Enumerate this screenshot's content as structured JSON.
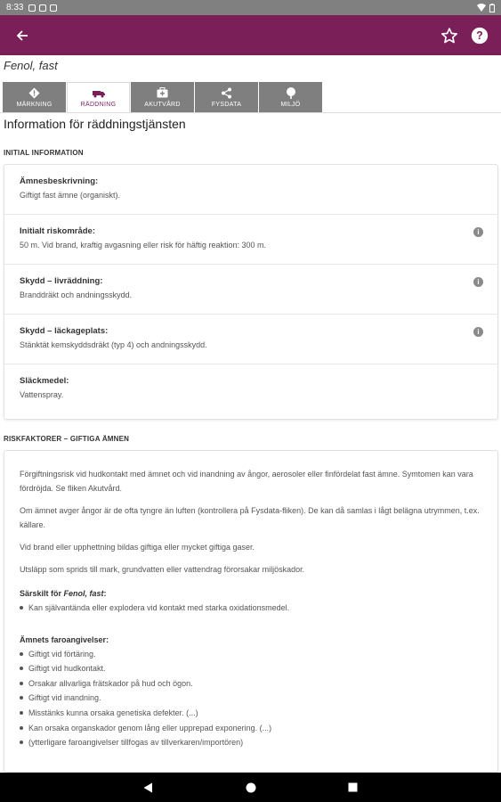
{
  "status_bar": {
    "time": "8:33"
  },
  "app_bar": {
    "back_icon": "arrow-left-icon",
    "favorite_icon": "star-outline-icon",
    "help_icon": "help-circle-icon",
    "color": "#7a1f57"
  },
  "substance": {
    "name": "Fenol, fast"
  },
  "tabs": [
    {
      "label": "MÄRKNING",
      "icon": "warning-diamond-icon",
      "active": false
    },
    {
      "label": "RÄDDNING",
      "icon": "fire-truck-icon",
      "active": true
    },
    {
      "label": "AKUTVÅRD",
      "icon": "first-aid-kit-icon",
      "active": false
    },
    {
      "label": "FYSDATA",
      "icon": "molecule-icon",
      "active": false
    },
    {
      "label": "MILJÖ",
      "icon": "tree-icon",
      "active": false
    }
  ],
  "page_title": "Information för räddningstjänsten",
  "initial_info": {
    "section_label": "INITIAL INFORMATION",
    "rows": [
      {
        "label": "Ämnesbeskrivning:",
        "value": "Giftigt fast ämne (organiskt).",
        "has_info": false
      },
      {
        "label": "Initialt riskområde:",
        "value": "50 m. Vid brand, kraftig avgasning eller risk för häftig reaktion: 300 m.",
        "has_info": true
      },
      {
        "label": "Skydd – livräddning:",
        "value": "Branddräkt och andningsskydd.",
        "has_info": true
      },
      {
        "label": "Skydd – läckageplats:",
        "value": "Stänktät kemskyddsdräkt (typ 4) och andningsskydd.",
        "has_info": true
      },
      {
        "label": "Släckmedel:",
        "value": "Vattenspray.",
        "has_info": false
      }
    ]
  },
  "risk_factors": {
    "section_label": "RISKFAKTORER – GIFTIGA ÄMNEN",
    "paragraphs": [
      "Förgiftningsrisk vid hudkontakt med ämnet och vid inandning av ångor, aerosoler eller finfördelat fast ämne. Symtomen kan vara fördröjda. Se fliken Akutvård.",
      "Om ämnet avger ångor är de ofta tyngre än luften (kontrollera på Fysdata-fliken). De kan då samlas i lågt belägna utrymmen, t.ex. källare.",
      "Vid brand eller upphettning bildas giftiga eller mycket giftiga gaser.",
      "Utsläpp som sprids till mark, grundvatten eller vattendrag förorsakar miljöskador."
    ],
    "special_heading_prefix": "Särskilt för ",
    "special_heading_name": "Fenol, fast",
    "special_heading_suffix": ":",
    "special_items": [
      "Kan självantända eller explodera vid kontakt med starka oxidationsmedel."
    ],
    "hazard_heading": "Ämnets faroangivelser:",
    "hazard_items": [
      "Giftigt vid förtäring.",
      "Giftigt vid hudkontakt.",
      "Orsakar allvarliga frätskador på hud och ögon.",
      "Giftigt vid inandning.",
      "Misstänks kunna orsaka genetiska defekter. (...)",
      "Kan orsaka organskador genom lång eller upprepad exponering. (...)",
      "(ytterligare faroangivelser tillfogas av tillverkaren/importören)"
    ]
  },
  "nav_bar": {
    "back_icon": "nav-back-triangle-icon",
    "home_icon": "nav-home-circle-icon",
    "recents_icon": "nav-recents-square-icon"
  }
}
